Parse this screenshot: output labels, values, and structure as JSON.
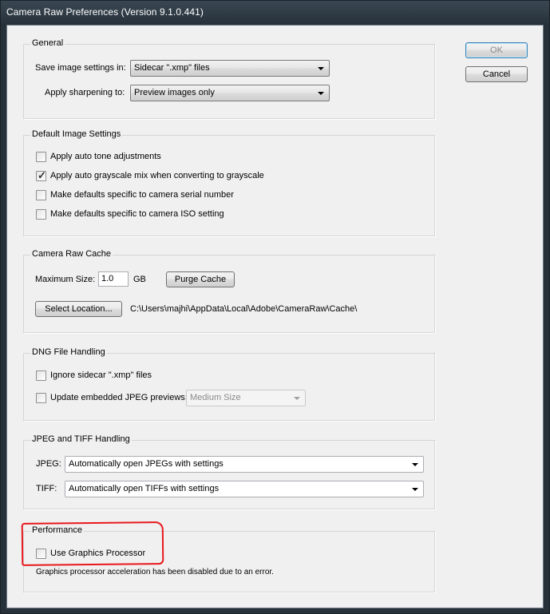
{
  "window": {
    "title": "Camera Raw Preferences  (Version 9.1.0.441)"
  },
  "buttons": {
    "ok": "OK",
    "cancel": "Cancel"
  },
  "general": {
    "legend": "General",
    "save_label": "Save image settings in:",
    "save_value": "Sidecar \".xmp\" files",
    "sharpen_label": "Apply sharpening to:",
    "sharpen_value": "Preview images only"
  },
  "default_image": {
    "legend": "Default Image Settings",
    "options": [
      {
        "label": "Apply auto tone adjustments",
        "checked": false
      },
      {
        "label": "Apply auto grayscale mix when converting to grayscale",
        "checked": true
      },
      {
        "label": "Make defaults specific to camera serial number",
        "checked": false
      },
      {
        "label": "Make defaults specific to camera ISO setting",
        "checked": false
      }
    ]
  },
  "cache": {
    "legend": "Camera Raw Cache",
    "max_size_label": "Maximum Size:",
    "max_size_value": "1.0",
    "unit": "GB",
    "purge_label": "Purge Cache",
    "select_location_label": "Select Location...",
    "path": "C:\\Users\\majhi\\AppData\\Local\\Adobe\\CameraRaw\\Cache\\"
  },
  "dng": {
    "legend": "DNG File Handling",
    "ignore_label": "Ignore sidecar \".xmp\" files",
    "ignore_checked": false,
    "update_label": "Update embedded JPEG previews:",
    "update_checked": false,
    "preview_size": "Medium Size"
  },
  "jpeg_tiff": {
    "legend": "JPEG and TIFF Handling",
    "jpeg_label": "JPEG:",
    "jpeg_value": "Automatically open JPEGs with settings",
    "tiff_label": "TIFF:",
    "tiff_value": "Automatically open TIFFs with settings"
  },
  "performance": {
    "legend": "Performance",
    "gpu_label": "Use Graphics Processor",
    "gpu_checked": false,
    "note": "Graphics processor acceleration has been disabled due to an error."
  },
  "colors": {
    "highlight": "#e8181d",
    "title_text": "#ffffff",
    "client_bg": "#f0f0f0"
  }
}
